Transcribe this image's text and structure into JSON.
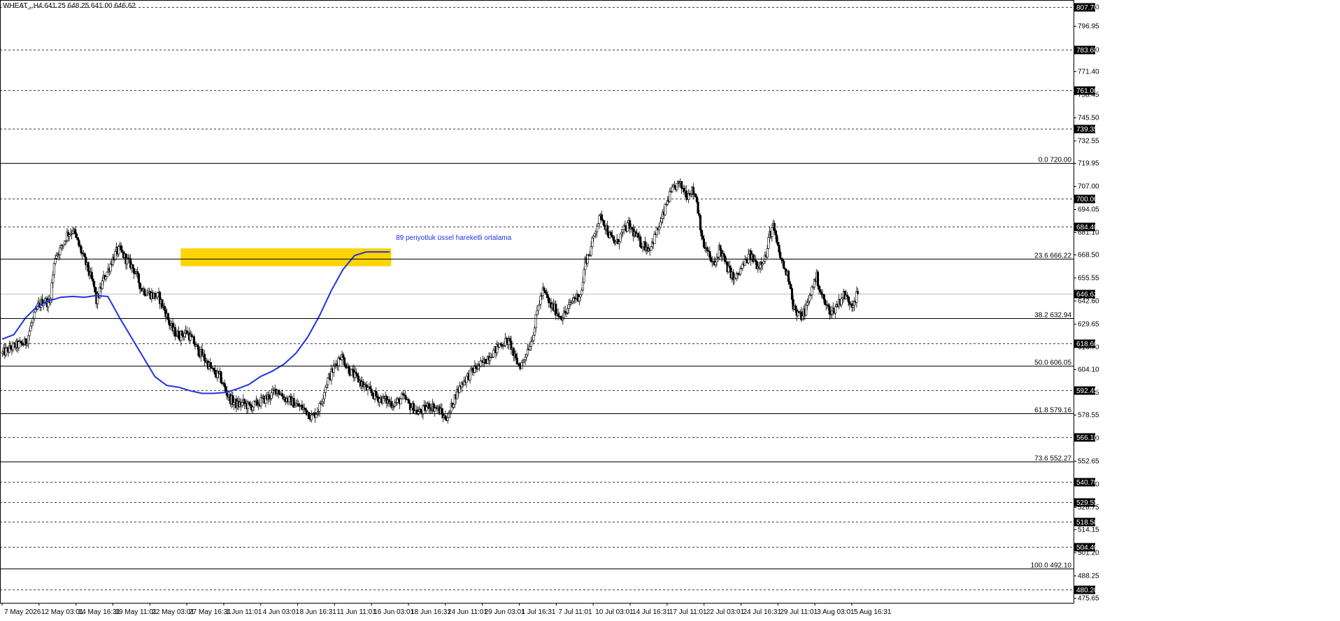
{
  "header": {
    "symbol_info": "WHEAT_,H4  641.25 648.25 641.00 646.62"
  },
  "chart_data": {
    "type": "candlestick",
    "title": "WHEAT_,H4  641.25 648.25 641.00 646.62",
    "ylim": [
      472.8,
      811.6
    ],
    "y_ticks": [
      "807.70",
      "796.95",
      "783.60",
      "771.40",
      "758.45",
      "745.50",
      "732.55",
      "719.95",
      "707.00",
      "694.05",
      "681.10",
      "668.50",
      "655.55",
      "642.60",
      "629.65",
      "616.70",
      "604.10",
      "591.15",
      "578.55",
      "565.60",
      "552.65",
      "539.70",
      "526.75",
      "514.15",
      "501.20",
      "488.25",
      "475.65"
    ],
    "x_labels": [
      "7 May 2026",
      "12 May 03:01",
      "14 May 16:31",
      "19 May 11:01",
      "22 May 03:01",
      "27 May 16:31",
      "1 Jun 11:01",
      "4 Jun 03:01",
      "8 Jun 16:31",
      "11 Jun 11:01",
      "16 Jun 03:01",
      "18 Jun 16:31",
      "24 Jun 11:01",
      "29 Jun 03:01",
      "1 Jul 16:31",
      "7 Jul 11:01",
      "10 Jul 03:01",
      "14 Jul 16:31",
      "17 Jul 11:01",
      "22 Jul 03:01",
      "24 Jul 16:31",
      "29 Jul 11:01",
      "3 Aug 03:01",
      "5 Aug 16:31"
    ],
    "horizontal_levels": [
      {
        "value": 807.7,
        "label": "807.70",
        "style": "dashed"
      },
      {
        "value": 783.6,
        "label": "783.60",
        "style": "dashed"
      },
      {
        "value": 761.0,
        "label": "761.00",
        "style": "dashed"
      },
      {
        "value": 739.35,
        "label": "739.35",
        "style": "dashed"
      },
      {
        "value": 700.0,
        "label": "700.00",
        "style": "dashed"
      },
      {
        "value": 684.4,
        "label": "684.40",
        "style": "dashed"
      },
      {
        "value": 618.6,
        "label": "618.60",
        "style": "dashed"
      },
      {
        "value": 592.45,
        "label": "592.45",
        "style": "dashed"
      },
      {
        "value": 566.1,
        "label": "566.10",
        "style": "dashed"
      },
      {
        "value": 540.7,
        "label": "540.70",
        "style": "dashed"
      },
      {
        "value": 529.55,
        "label": "529.55",
        "style": "dashed"
      },
      {
        "value": 518.5,
        "label": "518.50",
        "style": "dashed"
      },
      {
        "value": 504.4,
        "label": "504.40",
        "style": "dashed"
      },
      {
        "value": 480.2,
        "label": "480.20",
        "style": "dashed"
      }
    ],
    "fibonacci_levels": [
      {
        "value": 720.0,
        "label": "0.0 720.00"
      },
      {
        "value": 666.22,
        "label": "23.6 666.22"
      },
      {
        "value": 632.94,
        "label": "38.2 632.94"
      },
      {
        "value": 606.05,
        "label": "50.0 606.05"
      },
      {
        "value": 579.16,
        "label": "61.8 579.16"
      },
      {
        "value": 552.27,
        "label": "73.6 552.27"
      },
      {
        "value": 492.1,
        "label": "100.0 492.10"
      }
    ],
    "current_price": {
      "value": 646.62,
      "label": "646.62"
    },
    "zone": {
      "low": 662.0,
      "high": 672.0,
      "from_index": 152,
      "to_index": 230,
      "color": "#FFD400"
    },
    "ema_label": "89 periyotluk üssel hareketli ortalama",
    "ema_label_anchor": {
      "index": 231,
      "value": 678.0
    },
    "ema_color": "#1E32E6",
    "ema": [
      [
        0,
        621
      ],
      [
        10,
        623.5
      ],
      [
        20,
        633
      ],
      [
        30,
        639.5
      ],
      [
        40,
        642.5
      ],
      [
        50,
        644.5
      ],
      [
        60,
        645
      ],
      [
        70,
        644.5
      ],
      [
        80,
        645.5
      ],
      [
        90,
        645
      ],
      [
        100,
        633
      ],
      [
        110,
        622
      ],
      [
        120,
        611
      ],
      [
        130,
        600
      ],
      [
        140,
        595
      ],
      [
        150,
        594
      ],
      [
        160,
        592
      ],
      [
        170,
        590.5
      ],
      [
        180,
        590.5
      ],
      [
        190,
        591
      ],
      [
        200,
        593
      ],
      [
        210,
        595.5
      ],
      [
        220,
        600
      ],
      [
        230,
        603
      ],
      [
        240,
        607
      ],
      [
        250,
        613
      ],
      [
        260,
        622
      ],
      [
        270,
        634
      ],
      [
        280,
        648
      ],
      [
        290,
        660
      ],
      [
        300,
        668
      ],
      [
        310,
        670
      ],
      [
        320,
        670
      ],
      [
        330,
        670
      ]
    ],
    "candle_path": [
      [
        0,
        613
      ],
      [
        10,
        617
      ],
      [
        20,
        619
      ],
      [
        25,
        630
      ],
      [
        30,
        639
      ],
      [
        35,
        643
      ],
      [
        40,
        641
      ],
      [
        45,
        668
      ],
      [
        50,
        672
      ],
      [
        55,
        680
      ],
      [
        58,
        681
      ],
      [
        60,
        683
      ],
      [
        63,
        677
      ],
      [
        66,
        672
      ],
      [
        70,
        665
      ],
      [
        74,
        658
      ],
      [
        78,
        650
      ],
      [
        80,
        642
      ],
      [
        83,
        648
      ],
      [
        86,
        655
      ],
      [
        90,
        660
      ],
      [
        93,
        665
      ],
      [
        97,
        670
      ],
      [
        100,
        671
      ],
      [
        103,
        668
      ],
      [
        106,
        665
      ],
      [
        109,
        663
      ],
      [
        112,
        660
      ],
      [
        115,
        655
      ],
      [
        118,
        650
      ],
      [
        121,
        648
      ],
      [
        124,
        647
      ],
      [
        127,
        646
      ],
      [
        130,
        645
      ],
      [
        133,
        645
      ],
      [
        136,
        640
      ],
      [
        139,
        636
      ],
      [
        142,
        630
      ],
      [
        145,
        626
      ],
      [
        148,
        624
      ],
      [
        151,
        623
      ],
      [
        154,
        624
      ],
      [
        157,
        625
      ],
      [
        160,
        622
      ],
      [
        163,
        619
      ],
      [
        166,
        615
      ],
      [
        170,
        612
      ],
      [
        173,
        609
      ],
      [
        176,
        606
      ],
      [
        180,
        602
      ],
      [
        185,
        600
      ],
      [
        190,
        592
      ],
      [
        193,
        588
      ],
      [
        196,
        586
      ],
      [
        200,
        584
      ],
      [
        205,
        585
      ],
      [
        210,
        583
      ],
      [
        215,
        584
      ],
      [
        220,
        586
      ],
      [
        225,
        588
      ],
      [
        230,
        590
      ],
      [
        233,
        593
      ],
      [
        236,
        591
      ],
      [
        240,
        588
      ],
      [
        243,
        587
      ],
      [
        246,
        586
      ],
      [
        250,
        584
      ],
      [
        253,
        583
      ],
      [
        256,
        582
      ],
      [
        260,
        580
      ],
      [
        263,
        577
      ],
      [
        266,
        579
      ],
      [
        270,
        583
      ],
      [
        273,
        590
      ],
      [
        276,
        597
      ],
      [
        280,
        602
      ],
      [
        283,
        606
      ],
      [
        286,
        610
      ],
      [
        288,
        612
      ],
      [
        290,
        610
      ],
      [
        293,
        606
      ],
      [
        296,
        603
      ],
      [
        300,
        600
      ],
      [
        303,
        598
      ],
      [
        306,
        596
      ],
      [
        310,
        593
      ],
      [
        315,
        590
      ],
      [
        320,
        588
      ],
      [
        325,
        587
      ],
      [
        328,
        586
      ],
      [
        331,
        585
      ],
      [
        334,
        585
      ],
      [
        337,
        586
      ],
      [
        340,
        588
      ],
      [
        343,
        587
      ],
      [
        346,
        584
      ],
      [
        350,
        582
      ],
      [
        353,
        580
      ],
      [
        356,
        580
      ],
      [
        360,
        582
      ],
      [
        363,
        584
      ],
      [
        366,
        583
      ],
      [
        370,
        582
      ],
      [
        373,
        580
      ],
      [
        376,
        577
      ],
      [
        380,
        578
      ],
      [
        383,
        585
      ],
      [
        386,
        590
      ],
      [
        390,
        595
      ],
      [
        393,
        598
      ],
      [
        396,
        600
      ],
      [
        400,
        603
      ],
      [
        403,
        605
      ],
      [
        406,
        606
      ],
      [
        410,
        608
      ],
      [
        413,
        611
      ],
      [
        416,
        613
      ],
      [
        420,
        615
      ],
      [
        423,
        618
      ],
      [
        426,
        619
      ],
      [
        430,
        620
      ],
      [
        433,
        617
      ],
      [
        436,
        610
      ],
      [
        440,
        606
      ],
      [
        443,
        608
      ],
      [
        446,
        614
      ],
      [
        450,
        620
      ],
      [
        453,
        628
      ],
      [
        456,
        640
      ],
      [
        460,
        648
      ],
      [
        463,
        645
      ],
      [
        466,
        640
      ],
      [
        470,
        638
      ],
      [
        473,
        635
      ],
      [
        476,
        634
      ],
      [
        480,
        636
      ],
      [
        483,
        640
      ],
      [
        486,
        644
      ],
      [
        490,
        645
      ],
      [
        493,
        648
      ],
      [
        496,
        665
      ],
      [
        500,
        670
      ],
      [
        503,
        678
      ],
      [
        506,
        686
      ],
      [
        510,
        690
      ],
      [
        513,
        685
      ],
      [
        516,
        680
      ],
      [
        520,
        676
      ],
      [
        523,
        675
      ],
      [
        526,
        679
      ],
      [
        530,
        683
      ],
      [
        533,
        685
      ],
      [
        536,
        682
      ],
      [
        540,
        678
      ],
      [
        543,
        675
      ],
      [
        546,
        674
      ],
      [
        550,
        672
      ],
      [
        553,
        675
      ],
      [
        556,
        680
      ],
      [
        560,
        686
      ],
      [
        563,
        692
      ],
      [
        566,
        699
      ],
      [
        570,
        704
      ],
      [
        573,
        707
      ],
      [
        576,
        708
      ],
      [
        580,
        705
      ],
      [
        583,
        702
      ],
      [
        586,
        705
      ],
      [
        590,
        702
      ],
      [
        593,
        690
      ],
      [
        596,
        675
      ],
      [
        600,
        670
      ],
      [
        603,
        665
      ],
      [
        606,
        662
      ],
      [
        610,
        672
      ],
      [
        613,
        668
      ],
      [
        616,
        662
      ],
      [
        620,
        658
      ],
      [
        623,
        654
      ],
      [
        626,
        657
      ],
      [
        630,
        662
      ],
      [
        633,
        665
      ],
      [
        636,
        668
      ],
      [
        640,
        665
      ],
      [
        643,
        662
      ],
      [
        646,
        665
      ],
      [
        650,
        668
      ],
      [
        653,
        680
      ],
      [
        656,
        684
      ],
      [
        660,
        672
      ],
      [
        663,
        665
      ],
      [
        666,
        660
      ],
      [
        670,
        654
      ],
      [
        673,
        640
      ],
      [
        676,
        635
      ],
      [
        680,
        634
      ],
      [
        683,
        637
      ],
      [
        686,
        642
      ],
      [
        690,
        652
      ],
      [
        693,
        656
      ],
      [
        696,
        648
      ],
      [
        700,
        641
      ],
      [
        703,
        638
      ],
      [
        706,
        636
      ],
      [
        710,
        640
      ],
      [
        713,
        643
      ],
      [
        716,
        646
      ],
      [
        720,
        643
      ],
      [
        723,
        641
      ],
      [
        726,
        644
      ],
      [
        728,
        646.6
      ]
    ],
    "candle_count": 729
  }
}
